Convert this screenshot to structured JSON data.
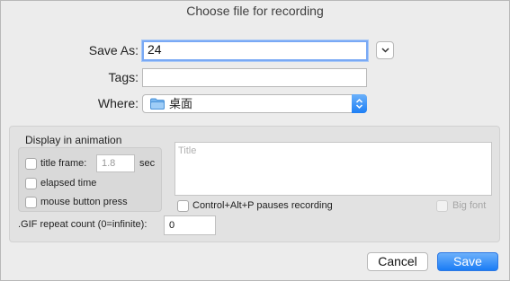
{
  "dialog": {
    "title": "Choose file for recording"
  },
  "form": {
    "save_as_label": "Save As:",
    "save_as_value": "24",
    "tags_label": "Tags:",
    "tags_value": "",
    "where_label": "Where:",
    "where_value": "桌面"
  },
  "animation": {
    "group_title": "Display in animation",
    "title_frame_label": "title frame:",
    "title_frame_value": "1.8",
    "title_frame_unit": "sec",
    "elapsed_time_label": "elapsed time",
    "mouse_button_label": "mouse button press",
    "title_placeholder": "Title",
    "pause_label": "Control+Alt+P pauses recording",
    "big_font_label": "Big font",
    "gif_repeat_label": ".GIF repeat count (0=infinite):",
    "gif_repeat_value": "0"
  },
  "buttons": {
    "cancel": "Cancel",
    "save": "Save"
  },
  "colors": {
    "accent": "#1d7ff5",
    "focus_ring": "#79a9f5",
    "window_bg": "#ececec"
  }
}
